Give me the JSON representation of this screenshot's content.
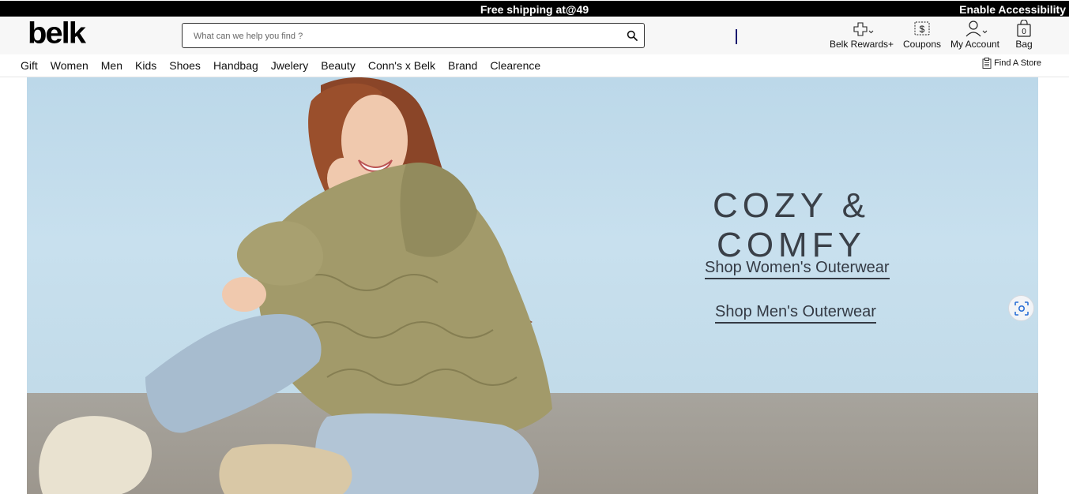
{
  "promo": {
    "shipping_text": "Free shipping at@49",
    "accessibility_label": "Enable Accessibility"
  },
  "header": {
    "logo_text": "belk",
    "search": {
      "placeholder": "What can we help you find ?"
    },
    "rewards_label": "Belk Rewards+",
    "coupons_label": "Coupons",
    "account_label": "My Account",
    "bag_label": "Bag",
    "bag_count": "0"
  },
  "nav": {
    "items": [
      "Gift",
      "Women",
      "Men",
      "Kids",
      "Shoes",
      "Handbag",
      "Jwelery",
      "Beauty",
      "Conn's x Belk",
      "Brand",
      "Clearence"
    ],
    "find_store_label": "Find A Store"
  },
  "hero": {
    "headline": "COZY & COMFY",
    "link_women": "Shop Women's Outerwear",
    "link_men": "Shop Men's Outerwear"
  },
  "icons": {
    "search": "search-icon",
    "rewards": "plus-icon",
    "coupons": "dollar-tag-icon",
    "account": "user-icon",
    "bag": "shopping-bag-icon",
    "store": "clipboard-icon",
    "lens": "visual-search-icon"
  },
  "colors": {
    "promo_bg": "#000000",
    "header_bg": "#f7f7f7",
    "hero_bg": "#c8e0ee",
    "hero_text": "#3a4048",
    "jacket": "#a29a6a"
  }
}
